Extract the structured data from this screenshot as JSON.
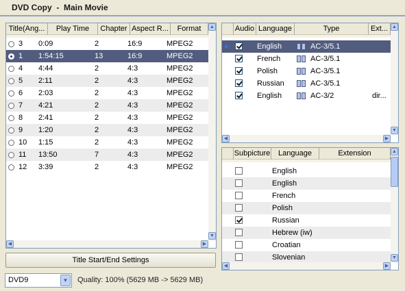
{
  "header": {
    "title": "DVD Copy  -  Main Movie"
  },
  "titles": {
    "columns": [
      "Title(Ang...",
      "Play Time",
      "Chapter",
      "Aspect R...",
      "Format"
    ],
    "rows": [
      {
        "title": "3",
        "time": "0:09",
        "chapter": "2",
        "aspect": "16:9",
        "format": "MPEG2",
        "selected": false
      },
      {
        "title": "1",
        "time": "1:54:15",
        "chapter": "13",
        "aspect": "16:9",
        "format": "MPEG2",
        "selected": true
      },
      {
        "title": "4",
        "time": "4:44",
        "chapter": "2",
        "aspect": "4:3",
        "format": "MPEG2",
        "selected": false
      },
      {
        "title": "5",
        "time": "2:11",
        "chapter": "2",
        "aspect": "4:3",
        "format": "MPEG2",
        "selected": false
      },
      {
        "title": "6",
        "time": "2:03",
        "chapter": "2",
        "aspect": "4:3",
        "format": "MPEG2",
        "selected": false
      },
      {
        "title": "7",
        "time": "4:21",
        "chapter": "2",
        "aspect": "4:3",
        "format": "MPEG2",
        "selected": false
      },
      {
        "title": "8",
        "time": "2:41",
        "chapter": "2",
        "aspect": "4:3",
        "format": "MPEG2",
        "selected": false
      },
      {
        "title": "9",
        "time": "1:20",
        "chapter": "2",
        "aspect": "4:3",
        "format": "MPEG2",
        "selected": false
      },
      {
        "title": "10",
        "time": "1:15",
        "chapter": "2",
        "aspect": "4:3",
        "format": "MPEG2",
        "selected": false
      },
      {
        "title": "11",
        "time": "13:50",
        "chapter": "7",
        "aspect": "4:3",
        "format": "MPEG2",
        "selected": false
      },
      {
        "title": "12",
        "time": "3:39",
        "chapter": "2",
        "aspect": "4:3",
        "format": "MPEG2",
        "selected": false
      }
    ]
  },
  "audio": {
    "columns": [
      "Audio",
      "Language",
      "Type",
      "Ext..."
    ],
    "rows": [
      {
        "checked": true,
        "language": "English",
        "type": "AC-3/5.1",
        "ext": "",
        "selected": true
      },
      {
        "checked": true,
        "language": "French",
        "type": "AC-3/5.1",
        "ext": "",
        "selected": false
      },
      {
        "checked": true,
        "language": "Polish",
        "type": "AC-3/5.1",
        "ext": "",
        "selected": false
      },
      {
        "checked": true,
        "language": "Russian",
        "type": "AC-3/5.1",
        "ext": "",
        "selected": false
      },
      {
        "checked": true,
        "language": "English",
        "type": "AC-3/2",
        "ext": "dir...",
        "selected": false
      }
    ]
  },
  "subpicture": {
    "columns": [
      "Subpicture",
      "Language",
      "Extension"
    ],
    "rows": [
      {
        "checked": false,
        "language": "English"
      },
      {
        "checked": false,
        "language": "English"
      },
      {
        "checked": false,
        "language": "French"
      },
      {
        "checked": false,
        "language": "Polish"
      },
      {
        "checked": true,
        "language": "Russian"
      },
      {
        "checked": false,
        "language": "Hebrew (iw)"
      },
      {
        "checked": false,
        "language": "Croatian"
      },
      {
        "checked": false,
        "language": "Slovenian"
      }
    ]
  },
  "buttons": {
    "title_settings": "Title Start/End Settings"
  },
  "target": {
    "value": "DVD9",
    "quality": "Quality: 100% (5629 MB -> 5629 MB)"
  },
  "colors": {
    "selection": "#525c7e",
    "border": "#7f9db9",
    "background": "#ece9d8"
  }
}
